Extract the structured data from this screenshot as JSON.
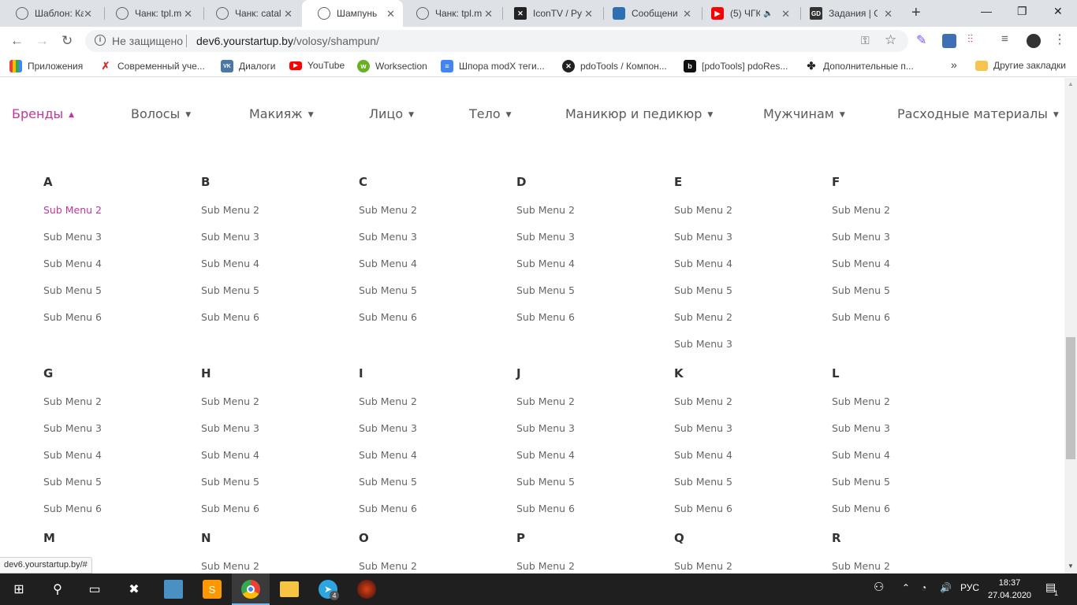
{
  "browser": {
    "tabs": [
      {
        "title": "Шаблон: Ка",
        "favicon": "globe-icon"
      },
      {
        "title": "Чанк: tpl.m",
        "favicon": "globe-icon"
      },
      {
        "title": "Чанк: catal",
        "favicon": "globe-icon"
      },
      {
        "title": "Шампунь",
        "favicon": "globe-icon",
        "active": true
      },
      {
        "title": "Чанк: tpl.m",
        "favicon": "globe-icon"
      },
      {
        "title": "IconTV / Ру",
        "favicon": "icontv-icon"
      },
      {
        "title": "Сообщени",
        "favicon": "vk-messages-icon"
      },
      {
        "title": "(5) ЧГК",
        "favicon": "youtube-icon"
      },
      {
        "title": "Задания | G",
        "favicon": "gd-icon"
      }
    ],
    "omnibox": {
      "security_label": "Не защищено",
      "url_host": "dev6.yourstartup.by",
      "url_path": "/volosy/shampun/"
    },
    "bookmarks": [
      {
        "label": "Приложения",
        "icon": "apps-grid-icon"
      },
      {
        "label": "Современный учe...",
        "icon": "teacher-icon"
      },
      {
        "label": "Диалоги",
        "icon": "vk-icon"
      },
      {
        "label": "YouTube",
        "icon": "youtube-icon"
      },
      {
        "label": "Worksection",
        "icon": "worksection-icon"
      },
      {
        "label": "Шпора modX теги...",
        "icon": "docs-icon"
      },
      {
        "label": "pdoTools / Компон...",
        "icon": "modx-icon"
      },
      {
        "label": "[pdoTools] pdoRes...",
        "icon": "b-icon"
      },
      {
        "label": "Дополнительные п...",
        "icon": "puzzle-icon"
      }
    ],
    "bookmarks_overflow": "»",
    "other_bookmarks": "Другие закладки",
    "status_url": "dev6.yourstartup.by/#"
  },
  "nav": [
    {
      "label": "Бренды",
      "caret": "▲",
      "active": true
    },
    {
      "label": "Волосы",
      "caret": "▼"
    },
    {
      "label": "Макияж",
      "caret": "▼"
    },
    {
      "label": "Лицо",
      "caret": "▼"
    },
    {
      "label": "Тело",
      "caret": "▼"
    },
    {
      "label": "Маникюр и педикюр",
      "caret": "▼"
    },
    {
      "label": "Мужчинам",
      "caret": "▼"
    },
    {
      "label": "Расходные материалы",
      "caret": "▼"
    }
  ],
  "brand_menu": {
    "row1": [
      {
        "letter": "A",
        "items": [
          "Sub Menu 2",
          "Sub Menu 3",
          "Sub Menu 4",
          "Sub Menu 5",
          "Sub Menu 6"
        ]
      },
      {
        "letter": "B",
        "items": [
          "Sub Menu 2",
          "Sub Menu 3",
          "Sub Menu 4",
          "Sub Menu 5",
          "Sub Menu 6"
        ]
      },
      {
        "letter": "C",
        "items": [
          "Sub Menu 2",
          "Sub Menu 3",
          "Sub Menu 4",
          "Sub Menu 5",
          "Sub Menu 6"
        ]
      },
      {
        "letter": "D",
        "items": [
          "Sub Menu 2",
          "Sub Menu 3",
          "Sub Menu 4",
          "Sub Menu 5",
          "Sub Menu 6"
        ]
      },
      {
        "letter": "E",
        "items": [
          "Sub Menu 2",
          "Sub Menu 3",
          "Sub Menu 4",
          "Sub Menu 5",
          "Sub Menu 2",
          "Sub Menu 3"
        ]
      },
      {
        "letter": "F",
        "items": [
          "Sub Menu 2",
          "Sub Menu 3",
          "Sub Menu 4",
          "Sub Menu 5",
          "Sub Menu 6"
        ]
      }
    ],
    "row2": [
      {
        "letter": "G",
        "items": [
          "Sub Menu 2",
          "Sub Menu 3",
          "Sub Menu 4",
          "Sub Menu 5",
          "Sub Menu 6"
        ]
      },
      {
        "letter": "H",
        "items": [
          "Sub Menu 2",
          "Sub Menu 3",
          "Sub Menu 4",
          "Sub Menu 5",
          "Sub Menu 6"
        ]
      },
      {
        "letter": "I",
        "items": [
          "Sub Menu 2",
          "Sub Menu 3",
          "Sub Menu 4",
          "Sub Menu 5",
          "Sub Menu 6"
        ]
      },
      {
        "letter": "J",
        "items": [
          "Sub Menu 2",
          "Sub Menu 3",
          "Sub Menu 4",
          "Sub Menu 5",
          "Sub Menu 6"
        ]
      },
      {
        "letter": "K",
        "items": [
          "Sub Menu 2",
          "Sub Menu 3",
          "Sub Menu 4",
          "Sub Menu 5",
          "Sub Menu 6"
        ]
      },
      {
        "letter": "L",
        "items": [
          "Sub Menu 2",
          "Sub Menu 3",
          "Sub Menu 4",
          "Sub Menu 5",
          "Sub Menu 6"
        ]
      }
    ],
    "row3": [
      {
        "letter": "M",
        "items": []
      },
      {
        "letter": "N",
        "items": [
          "Sub Menu 2"
        ]
      },
      {
        "letter": "O",
        "items": [
          "Sub Menu 2"
        ]
      },
      {
        "letter": "P",
        "items": [
          "Sub Menu 2"
        ]
      },
      {
        "letter": "Q",
        "items": [
          "Sub Menu 2"
        ]
      },
      {
        "letter": "R",
        "items": [
          "Sub Menu 2"
        ]
      }
    ]
  },
  "taskbar": {
    "language": "РУС",
    "time": "18:37",
    "date": "27.04.2020",
    "telegram_badge": "4",
    "notification_badge": "1"
  },
  "colors": {
    "accent": "#c0379a",
    "text": "#5b5b5b"
  }
}
